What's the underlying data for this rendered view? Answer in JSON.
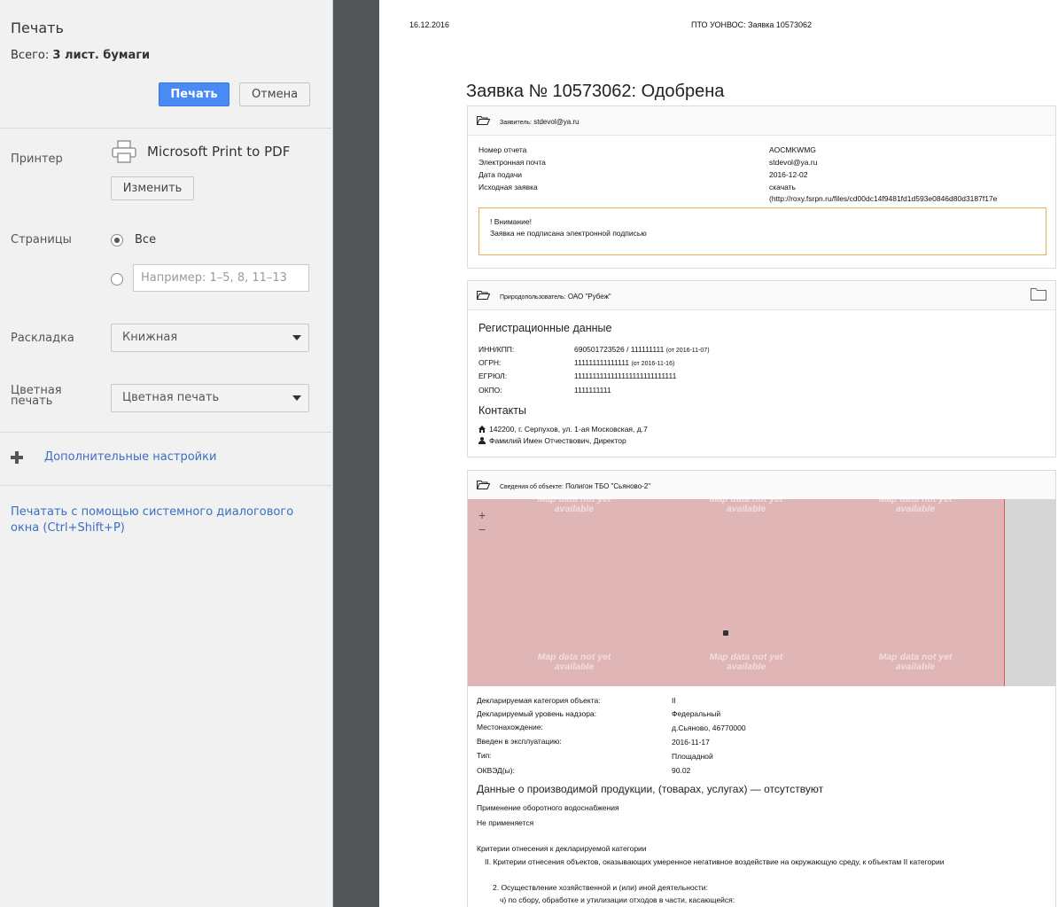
{
  "panel": {
    "title": "Печать",
    "total_prefix": "Всего:",
    "total_value": "3 лист. бумаги",
    "print_button": "Печать",
    "cancel_button": "Отмена",
    "printer_label": "Принтер",
    "printer_name": "Microsoft Print to PDF",
    "change_button": "Изменить",
    "pages_label": "Страницы",
    "pages_all": "Все",
    "pages_placeholder": "Например: 1–5, 8, 11–13",
    "layout_label": "Раскладка",
    "layout_value": "Книжная",
    "color_label": "Цветная печать",
    "color_value": "Цветная печать",
    "more_settings": "Дополнительные настройки",
    "system_dialog": "Печатать с помощью системного диалогового окна (Ctrl+Shift+P)",
    "accent_color": "#4a8af4"
  },
  "doc": {
    "header_date": "16.12.2016",
    "header_title": "ПТО УОНВОС: Заявка 10573062",
    "title": "Заявка № 10573062: Одобрена",
    "applicant": {
      "prefix": "Заявитель:",
      "value": "stdevol@ya.ru",
      "rows": [
        {
          "label": "Номер отчета",
          "value": "AOCMKWMG"
        },
        {
          "label": "Электронная почта",
          "value": "stdevol@ya.ru"
        },
        {
          "label": "Дата подачи",
          "value": "2016-12-02"
        },
        {
          "label": "Исходная заявка",
          "value": "скачать"
        }
      ],
      "link_url": "(http://roxy.fsrpn.ru/files/cd00dc14f9481fd1d593e0846d80d3187f17e",
      "warning_title": "! Внимание!",
      "warning_text": "Заявка не подписана электронной подписью"
    },
    "user": {
      "prefix": "Природопользователь:",
      "value": "ОАО \"Рубеж\"",
      "reg_heading": "Регистрационные данные",
      "rows": [
        {
          "label": "ИНН/КПП:",
          "value": "690501723526 / 111111111",
          "note": "(от 2016-11-07)"
        },
        {
          "label": "ОГРН:",
          "value": "111111111111111",
          "note": "(от 2016-11-16)"
        },
        {
          "label": "ЕГРЮЛ:",
          "value": "1111111111111111111111111111",
          "note": ""
        },
        {
          "label": "ОКПО:",
          "value": "1111111111",
          "note": ""
        }
      ],
      "contacts_heading": "Контакты",
      "address": "142200, г. Серпухов, ул. 1-ая Московская, д.7",
      "person": "Фамилий Имен Отчествович, Директор"
    },
    "object": {
      "prefix": "Сведения об объекте:",
      "value": "Полигон ТБО \"Сьяново-2\"",
      "map_watermark": "Map data not yet available",
      "zoom_in": "+",
      "zoom_out": "−",
      "rows": [
        {
          "label": "Декларируемая категория объекта:",
          "value": "II"
        },
        {
          "label": "Декларируемый уровень надзора:",
          "value": "Федеральный"
        },
        {
          "label": "Местонахождение:",
          "value": "д.Сьяново, 46770000"
        },
        {
          "label": "Введен в эксплуатацию:",
          "value": "2016-11-17"
        },
        {
          "label": "Тип:",
          "value": "Площадной"
        },
        {
          "label": "ОКВЭД(ы):",
          "value": "90.02"
        }
      ],
      "products_heading": "Данные о производимой продукции, (товарах, услугах) — отсутствуют",
      "water_label": "Применение оборотного водоснабжения",
      "water_value": "Не применяется",
      "criteria_heading": "Критерии отнесения к декларируемой категории",
      "criteria_1": "II. Критерии отнесения объектов, оказывающих умеренное негативное воздействие на окружающую среду, к объектам II категории",
      "criteria_2": "2. Осуществление хозяйственной и (или) иной деятельности:",
      "criteria_3": "ч) по сбору, обработке и утилизации отходов в части, касающейся:"
    }
  }
}
